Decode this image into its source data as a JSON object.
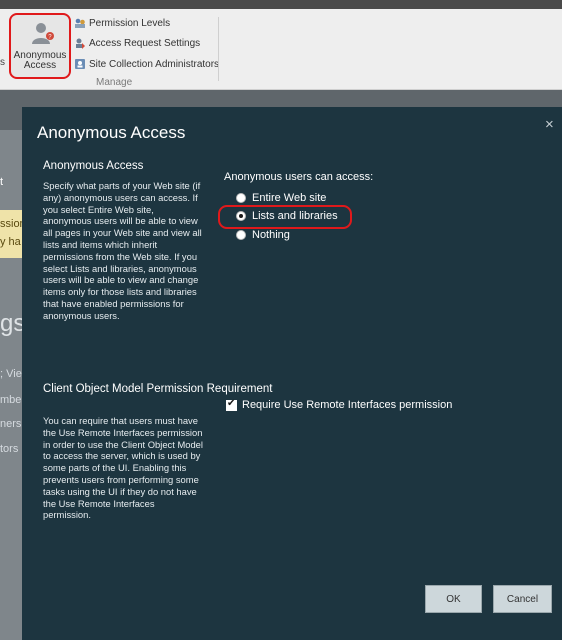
{
  "ribbon": {
    "left_fragment": "s",
    "anon_button": "Anonymous Access",
    "items": [
      "Permission Levels",
      "Access Request Settings",
      "Site Collection Administrators"
    ],
    "group_label": "Manage"
  },
  "background": {
    "fragments": [
      "t",
      "ssion",
      "y ha",
      "gs",
      "; Vie",
      "mbe",
      "ners",
      "tors"
    ]
  },
  "dialog": {
    "title": "Anonymous Access",
    "close_glyph": "×",
    "section1": {
      "heading": "Anonymous Access",
      "text": "Specify what parts of your Web site (if any) anonymous users can access. If you select Entire Web site, anonymous users will be able to view all pages in your Web site and view all lists and items which inherit permissions from the Web site. If you select Lists and libraries, anonymous users will be able to view and change items only for those lists and libraries that have enabled permissions for anonymous users."
    },
    "access": {
      "heading": "Anonymous users can access:",
      "options": [
        "Entire Web site",
        "Lists and libraries",
        "Nothing"
      ],
      "selected": "Lists and libraries"
    },
    "section2": {
      "heading": "Client Object Model Permission Requirement",
      "text": "You can require that users must have the Use Remote Interfaces permission in order to use the Client Object Model to access the server, which is used by some parts of the UI. Enabling this prevents users from performing some tasks using the UI if they do not have the Use Remote Interfaces permission."
    },
    "checkbox": {
      "label": "Require Use Remote Interfaces permission",
      "checked": true
    },
    "buttons": {
      "ok": "OK",
      "cancel": "Cancel"
    }
  },
  "colors": {
    "dialog_bg": "#1d3540",
    "highlight": "#e0191b",
    "ribbon_bg": "#eeeeee"
  }
}
